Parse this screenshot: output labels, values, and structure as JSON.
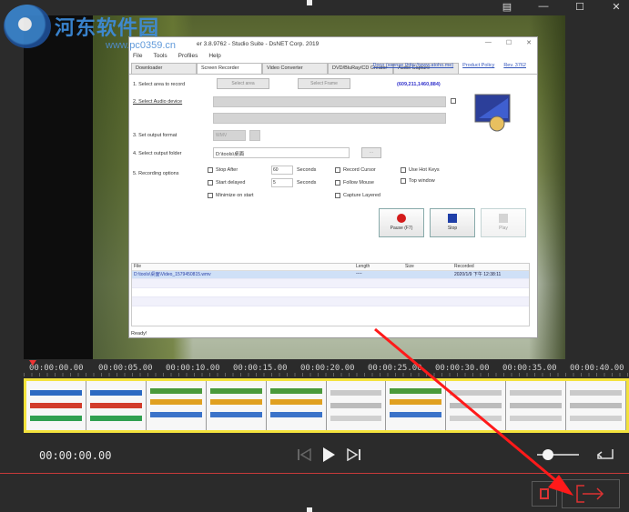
{
  "watermark": {
    "text": "河东软件园",
    "url": "www.pc0359.cn"
  },
  "inner_app": {
    "title": "er 3.8.9762 - Studio Suite - DsNET Corp. 2019",
    "menu": [
      "File",
      "Tools",
      "Profiles",
      "Help"
    ],
    "links": [
      "Doco (ssense (http://www.atoho.me)",
      "Product Policy",
      "Rev. 3762"
    ],
    "tabs": [
      "Downloader",
      "Screen Recorder",
      "Video Converter",
      "DVD/BluRay/CD Creator",
      "Audio Capture"
    ],
    "active_tab_index": 1,
    "steps": [
      "1. Select area to record",
      "2. Select Audio device",
      "3. Set output format",
      "4. Select output folder",
      "5. Recording options"
    ],
    "select_area_label": "Select area",
    "select_frame_label": "Select Frame",
    "coords": "(609,211,1460,884)",
    "format": "WMV",
    "output_folder": "D:\\tools\\桌面",
    "browse": "...",
    "options": {
      "stop_after": "Stop After",
      "stop_after_value": "60",
      "stop_after_unit": "Seconds",
      "start_delayed": "Start delayed",
      "start_delayed_value": "5",
      "start_delayed_unit": "Seconds",
      "minimize": "Minimize on start",
      "record_cursor": "Record Cursor",
      "follow_mouse": "Follow Mouse",
      "capture_layered": "Capture Layered",
      "hot_keys": "Use Hot Keys",
      "top_window": "Top window"
    },
    "buttons": {
      "pause": "Pause (F7)",
      "stop": "Stop",
      "play": "Play"
    },
    "filelist": {
      "headers": [
        "File",
        "Length",
        "Size",
        "Recorded"
      ],
      "row": [
        "D:\\tools\\桌面\\Video_1579450815.wmv",
        "----",
        "",
        "2020/1/9 下午 12:38:11"
      ]
    },
    "status": "Ready!"
  },
  "timeline": {
    "ticks": [
      "00:00:00.00",
      "00:00:05.00",
      "00:00:10.00",
      "00:00:15.00",
      "00:00:20.00",
      "00:00:25.00",
      "00:00:30.00",
      "00:00:35.00",
      "00:00:40.00"
    ]
  },
  "player": {
    "timecode": "00:00:00.00"
  },
  "colors": {
    "accent": "#e33b3b",
    "track_border": "#f3e23c"
  }
}
